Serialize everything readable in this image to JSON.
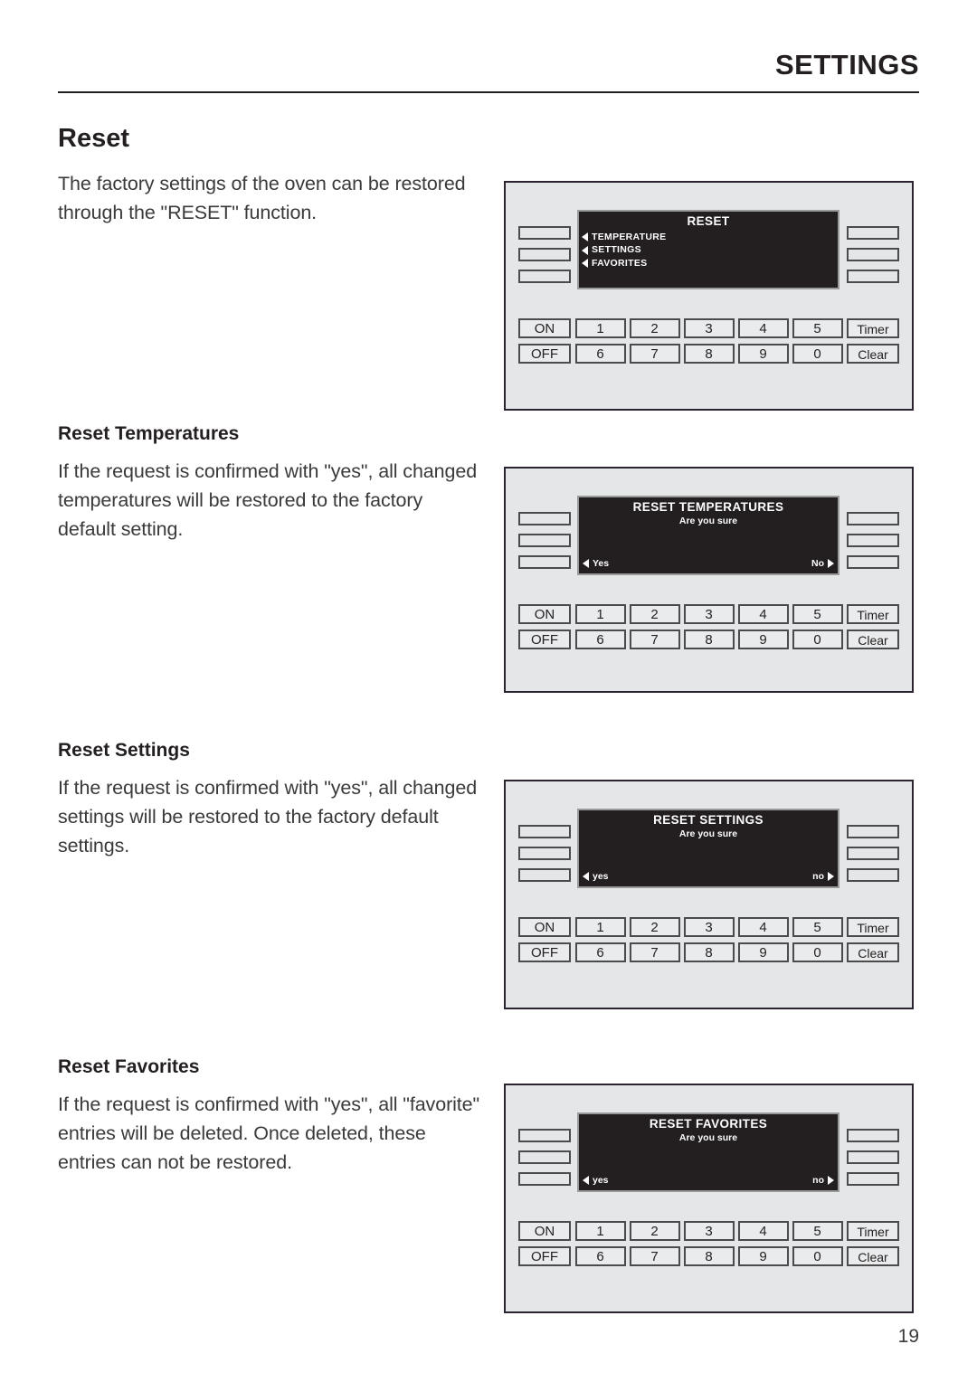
{
  "header": {
    "title": "SETTINGS"
  },
  "page_number": "19",
  "sections": {
    "reset": {
      "heading": "Reset",
      "body": "The factory settings of the oven can be restored through the \"RESET\" function."
    },
    "reset_temperatures": {
      "heading": "Reset Temperatures",
      "body": "If the request is confirmed with \"yes\", all changed temperatures will be restored to the factory default setting."
    },
    "reset_settings": {
      "heading": "Reset Settings",
      "body": "If the request is confirmed with \"yes\", all changed settings will be restored to the factory default settings."
    },
    "reset_favorites": {
      "heading": "Reset Favorites",
      "body": "If the request is confirmed with \"yes\", all \"favorite\" entries will be deleted. Once deleted, these entries can not be restored."
    }
  },
  "keypad": {
    "on": "ON",
    "off": "OFF",
    "timer": "Timer",
    "clear": "Clear",
    "row1": [
      "1",
      "2",
      "3",
      "4",
      "5"
    ],
    "row2": [
      "6",
      "7",
      "8",
      "9",
      "0"
    ]
  },
  "panels": {
    "reset_menu": {
      "lcd_title": "RESET",
      "menu": [
        "TEMPERATURE",
        "SETTINGS",
        "FAVORITES"
      ]
    },
    "reset_temperatures": {
      "lcd_title": "RESET TEMPERATURES",
      "lcd_sub": "Are you sure",
      "yes": "Yes",
      "no": "No"
    },
    "reset_settings": {
      "lcd_title": "RESET SETTINGS",
      "lcd_sub": "Are you sure",
      "yes": "yes",
      "no": "no"
    },
    "reset_favorites": {
      "lcd_title": "RESET FAVORITES",
      "lcd_sub": "Are you sure",
      "yes": "yes",
      "no": "no"
    }
  },
  "colors": {
    "ink": "#231f20",
    "panel_face": "#e4e6e7",
    "lcd_background": "#231f20",
    "lcd_text": "#ffffff"
  }
}
